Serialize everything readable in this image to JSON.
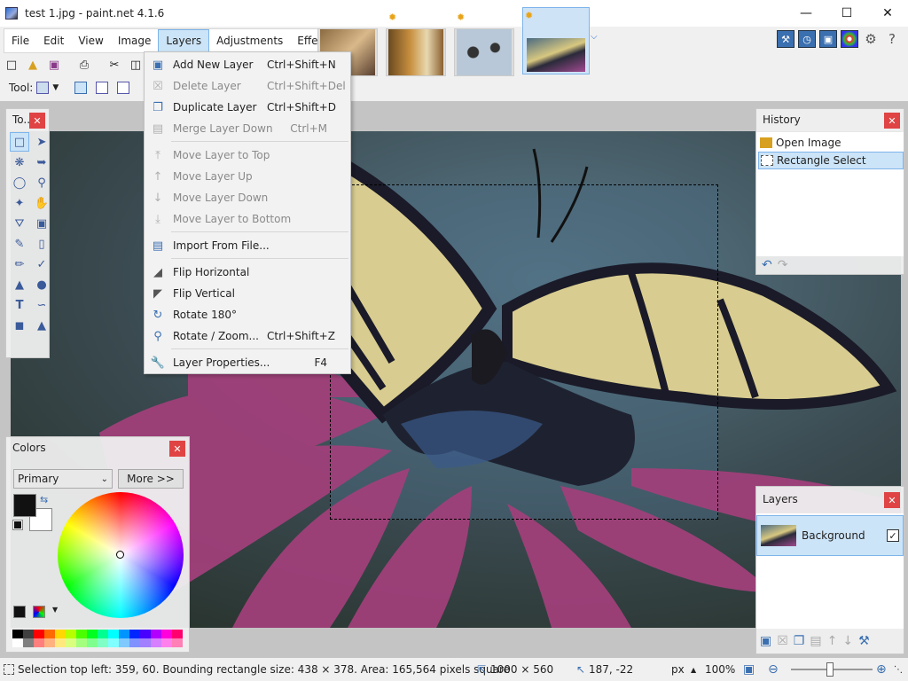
{
  "window": {
    "title": "test 1.jpg - paint.net 4.1.6"
  },
  "menubar": [
    "File",
    "Edit",
    "View",
    "Image",
    "Layers",
    "Adjustments",
    "Effects"
  ],
  "toolbar": {
    "tool_label": "Tool:"
  },
  "layers_menu": {
    "items": [
      {
        "label": "Add New Layer",
        "shortcut": "Ctrl+Shift+N",
        "enabled": true,
        "icon": "add-layer-icon"
      },
      {
        "label": "Delete Layer",
        "shortcut": "Ctrl+Shift+Del",
        "enabled": false,
        "icon": "delete-layer-icon"
      },
      {
        "label": "Duplicate Layer",
        "shortcut": "Ctrl+Shift+D",
        "enabled": true,
        "icon": "duplicate-layer-icon"
      },
      {
        "label": "Merge Layer Down",
        "shortcut": "Ctrl+M",
        "enabled": false,
        "icon": "merge-down-icon"
      },
      {
        "label": "Move Layer to Top",
        "shortcut": "",
        "enabled": false,
        "icon": "move-top-icon"
      },
      {
        "label": "Move Layer Up",
        "shortcut": "",
        "enabled": false,
        "icon": "move-up-icon"
      },
      {
        "label": "Move Layer Down",
        "shortcut": "",
        "enabled": false,
        "icon": "move-down-icon"
      },
      {
        "label": "Move Layer to Bottom",
        "shortcut": "",
        "enabled": false,
        "icon": "move-bottom-icon"
      },
      {
        "label": "Import From File...",
        "shortcut": "",
        "enabled": true,
        "icon": "import-icon"
      },
      {
        "label": "Flip Horizontal",
        "shortcut": "",
        "enabled": true,
        "icon": "flip-horizontal-icon"
      },
      {
        "label": "Flip Vertical",
        "shortcut": "",
        "enabled": true,
        "icon": "flip-vertical-icon"
      },
      {
        "label": "Rotate 180°",
        "shortcut": "",
        "enabled": true,
        "icon": "rotate-icon"
      },
      {
        "label": "Rotate / Zoom...",
        "shortcut": "Ctrl+Shift+Z",
        "enabled": true,
        "icon": "rotate-zoom-icon"
      },
      {
        "label": "Layer Properties...",
        "shortcut": "F4",
        "enabled": true,
        "icon": "wrench-icon"
      }
    ]
  },
  "tools_panel": {
    "title": "To..."
  },
  "history_panel": {
    "title": "History",
    "items": [
      "Open Image",
      "Rectangle Select"
    ]
  },
  "colors_panel": {
    "title": "Colors",
    "mode": "Primary",
    "more_label": "More >>"
  },
  "layers_panel": {
    "title": "Layers",
    "layers": [
      {
        "name": "Background",
        "visible": true
      }
    ]
  },
  "statusbar": {
    "selection_info": "Selection top left: 359, 60. Bounding rectangle size: 438 × 378. Area: 165,564 pixels square",
    "image_size": "1000 × 560",
    "cursor_pos": "187, -22",
    "units": "px",
    "zoom": "100%"
  }
}
